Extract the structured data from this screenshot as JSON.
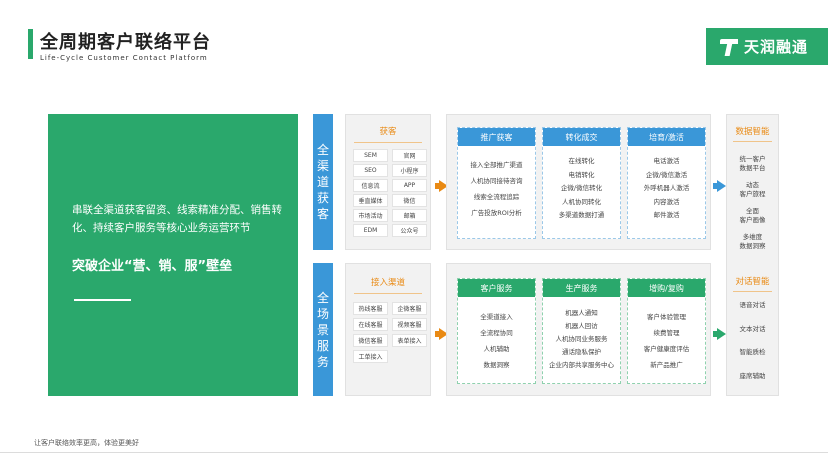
{
  "header": {
    "title": "全周期客户联络平台",
    "subtitle": "Life-Cycle Customer Contact Platform",
    "logo_text": "天润融通"
  },
  "left_panel": {
    "description": "串联全渠道获客留资、线索精准分配、销售转化、持续客户服务等核心业务运营环节",
    "slogan": "突破企业“营、销、服”壁垒"
  },
  "row_labels": {
    "acquire": [
      "全",
      "渠",
      "道",
      "获",
      "客"
    ],
    "service": [
      "全",
      "场",
      "景",
      "服",
      "务"
    ]
  },
  "acquire_channels": {
    "title": "获客",
    "tags": [
      "SEM",
      "官网",
      "SEO",
      "小程序",
      "信息流",
      "APP",
      "垂直媒体",
      "微信",
      "市场活动",
      "邮箱",
      "EDM",
      "公众号"
    ]
  },
  "service_channels": {
    "title": "接入渠道",
    "tags": [
      "热线客服",
      "企微客服",
      "在线客服",
      "视频客服",
      "微信客服",
      "表单接入",
      "工单接入"
    ]
  },
  "acquire_cards": [
    {
      "title": "推广获客",
      "items": [
        "接入全部推广渠道",
        "人机协同接待咨询",
        "线索全流程追踪",
        "广告投放ROI分析"
      ]
    },
    {
      "title": "转化成交",
      "items": [
        "在线转化",
        "电销转化",
        "企微/微信转化",
        "人机协同转化",
        "多渠道数据打通"
      ]
    },
    {
      "title": "培育/激活",
      "items": [
        "电话激活",
        "企微/微信激活",
        "外呼机器人激活",
        "内容激活",
        "邮件激活"
      ]
    }
  ],
  "service_cards": [
    {
      "title": "客户服务",
      "items": [
        "全渠道接入",
        "全流程协同",
        "人机辅助",
        "数据洞察"
      ]
    },
    {
      "title": "生产服务",
      "items": [
        "机器人通知",
        "机器人回访",
        "人机协同业务服务",
        "通话隐私保护",
        "企业内部共享服务中心"
      ]
    },
    {
      "title": "增购/复购",
      "items": [
        "客户体验管理",
        "续费管理",
        "客户健康度评估",
        "新产品推广"
      ]
    }
  ],
  "right_column": {
    "data_title": "数据智能",
    "data_items": [
      [
        "统一客户",
        "数据平台"
      ],
      [
        "动态",
        "客户旅程"
      ],
      [
        "全面",
        "客户画像"
      ],
      [
        "多维度",
        "数据洞察"
      ]
    ],
    "dialog_title": "对话智能",
    "dialog_items": [
      "语音对话",
      "文本对话",
      "智能质检",
      "座席辅助"
    ]
  },
  "footer": {
    "text": "让客户联络效率更高，体验更美好"
  },
  "colors": {
    "brand_green": "#2aa86c",
    "accent_blue": "#3a97d8",
    "accent_orange": "#e98a14"
  }
}
